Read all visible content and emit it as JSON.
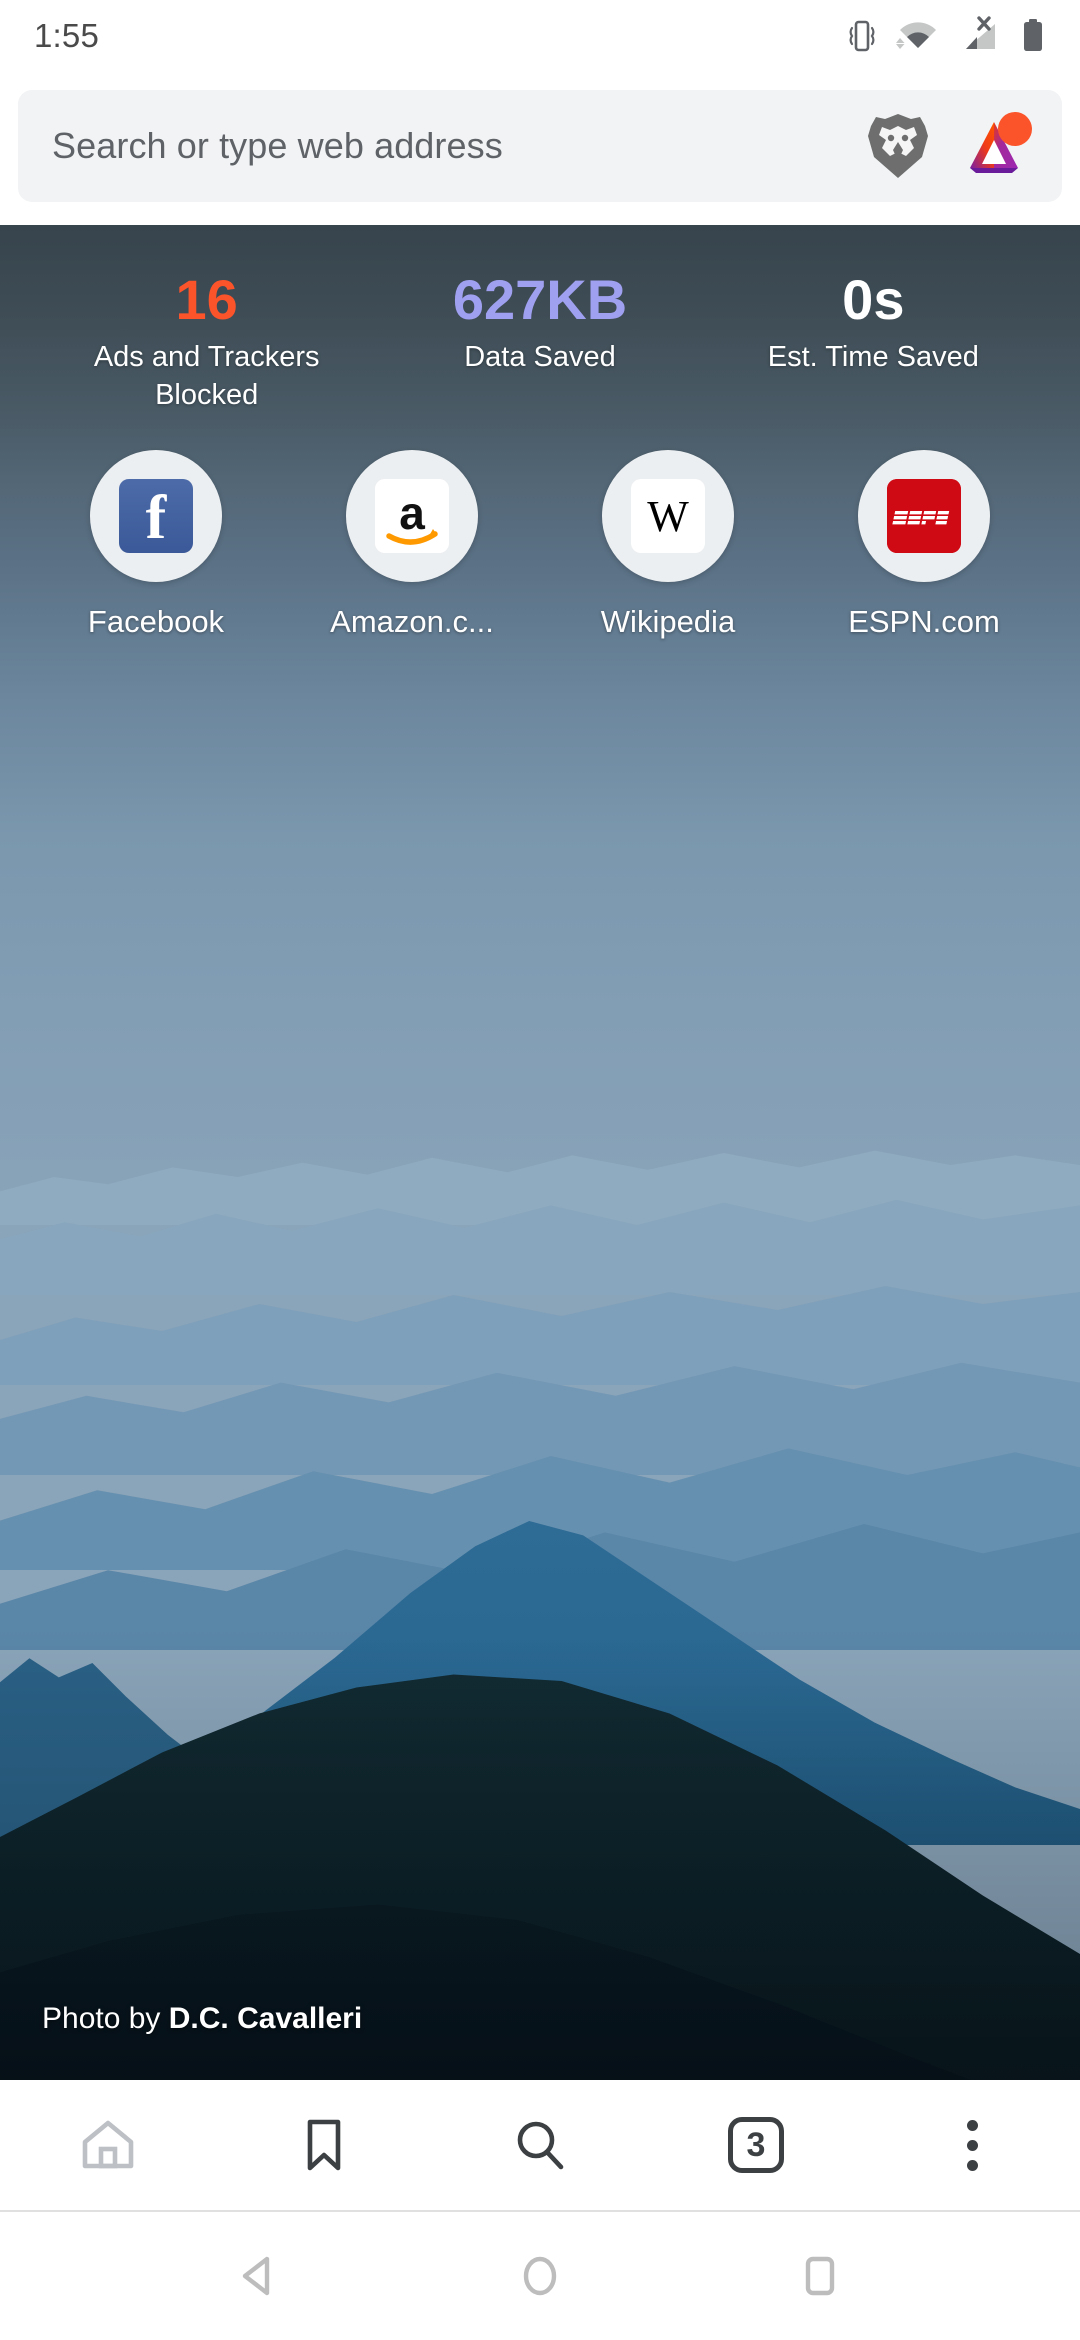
{
  "status_bar": {
    "time": "1:55",
    "icons": [
      "vibrate-icon",
      "wifi-icon",
      "cellular-no-sim-icon",
      "battery-icon"
    ]
  },
  "url_bar": {
    "placeholder": "Search or type web address",
    "value": "",
    "shield_icon": "brave-lion-shield-icon",
    "rewards_icon": "bat-triangle-icon",
    "rewards_badge": true
  },
  "stats": [
    {
      "value": "16",
      "label": "Ads and Trackers Blocked",
      "color": "#fb542b"
    },
    {
      "value": "627KB",
      "label": "Data Saved",
      "color": "#a0a0f0"
    },
    {
      "value": "0s",
      "label": "Est. Time Saved",
      "color": "#ffffff"
    }
  ],
  "shortcuts": [
    {
      "label": "Facebook",
      "icon": "facebook-icon"
    },
    {
      "label": "Amazon.c...",
      "icon": "amazon-icon"
    },
    {
      "label": "Wikipedia",
      "icon": "wikipedia-icon"
    },
    {
      "label": "ESPN.com",
      "icon": "espn-icon"
    }
  ],
  "photo_credit": {
    "prefix": "Photo by ",
    "author": "D.C. Cavalleri"
  },
  "toolbar": {
    "home": "home-icon",
    "bookmarks": "bookmark-icon",
    "search": "search-icon",
    "tab_count": "3",
    "menu": "three-dot-menu-icon"
  },
  "nav_bar": {
    "back": "back-triangle-icon",
    "home": "home-circle-icon",
    "recents": "recents-square-icon"
  },
  "colors": {
    "brave_orange": "#fb542b",
    "data_purple": "#a0a0f0",
    "urlbar_bg": "#f1f3f4",
    "espn_red": "#d00a14",
    "facebook_blue": "#3b5998"
  }
}
